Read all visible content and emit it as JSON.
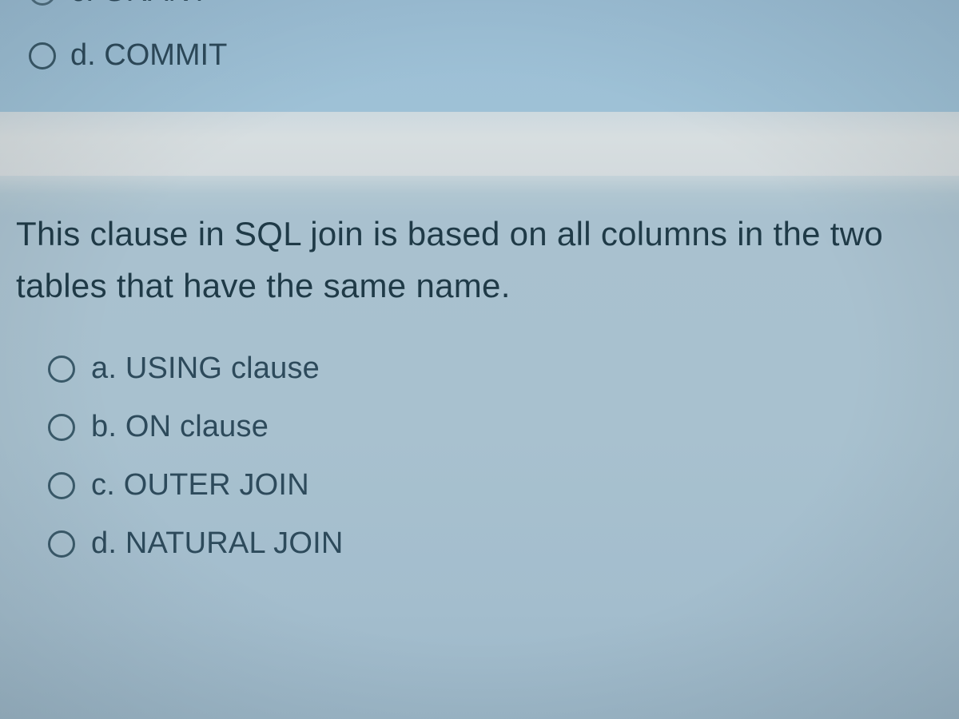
{
  "prev_question": {
    "option_c": "c. GRANT",
    "option_d": "d. COMMIT"
  },
  "question": {
    "line1": "This clause in SQL join is based on all columns in the two",
    "line2": "tables that have the same name."
  },
  "options": {
    "a": "a. USING clause",
    "b": "b. ON clause",
    "c": "c. OUTER JOIN",
    "d": "d. NATURAL JOIN"
  }
}
